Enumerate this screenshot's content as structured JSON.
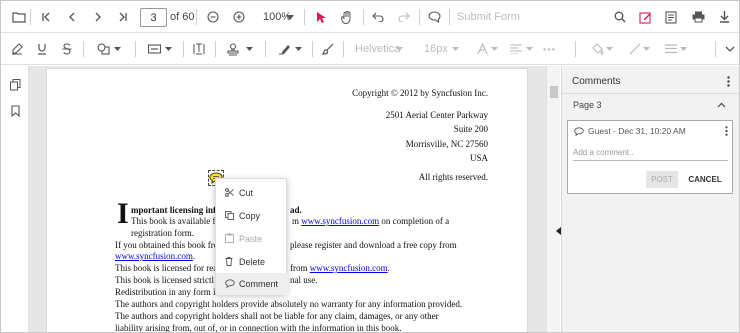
{
  "toolbar": {
    "page_current": "3",
    "page_total": "of 60",
    "zoom": "100%",
    "submit_form": "Submit Form"
  },
  "annot_toolbar": {
    "font_family": "Helvetica",
    "font_size": "16px"
  },
  "document": {
    "copyright": "Copyright © 2012 by Syncfusion Inc.",
    "address1": "2501 Aerial Center Parkway",
    "address2": "Suite 200",
    "address3": "Morrisville, NC 27560",
    "address4": "USA",
    "rights": "All rights reserved.",
    "dropcap": "I",
    "heading": "mportant licensing info",
    "heading_tail": "ad.",
    "p1a": "This book is available f",
    "p1b": "m",
    "p1_link": "www.syncfusion.com",
    "p1c": "on completion of a",
    "p1d": "registration form.",
    "p2a": "If you obtained this book fro",
    "p2b": "please register and download a free copy from",
    "p2_link": "www.syncfusion.com",
    "p2c": ".",
    "p3a": "This book is licensed for rea",
    "p3b": "from",
    "p3_link": "www.syncfusion.com",
    "p3c": ".",
    "p4a": "This book is licensed strictl",
    "p4b": "nal use.",
    "p5": "Redistribution in any form is",
    "p6": "The authors and copyright holders provide absolutely no warranty for any information provided.",
    "p7": "The authors and copyright holders shall not be liable for any claim, damages, or any other",
    "p8": "liability arising from, out of, or in connection with the information in this book."
  },
  "context_menu": {
    "items": [
      {
        "label": "Cut",
        "icon": "scissors-icon"
      },
      {
        "label": "Copy",
        "icon": "copy-icon"
      },
      {
        "label": "Paste",
        "icon": "paste-icon"
      },
      {
        "label": "Delete",
        "icon": "trash-icon"
      },
      {
        "label": "Comment",
        "icon": "comment-icon"
      }
    ]
  },
  "comments": {
    "title": "Comments",
    "page_label": "Page 3",
    "author_date": "Guest - Dec 31, 10:20 AM",
    "placeholder": "Add a comment..",
    "post": "POST",
    "cancel": "CANCEL"
  },
  "colors": {
    "accent": "#e3165b",
    "sticky_note": "#ffee00"
  }
}
